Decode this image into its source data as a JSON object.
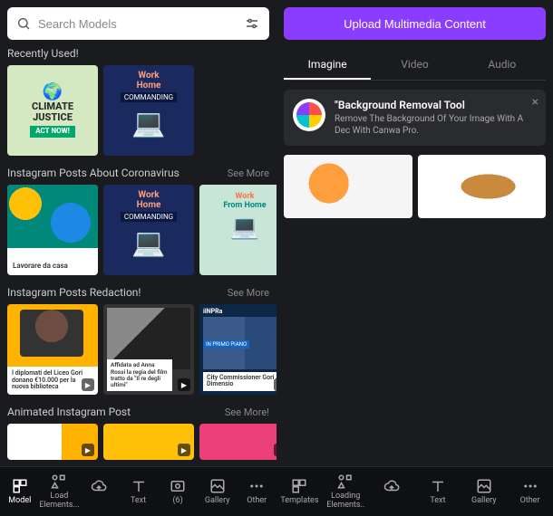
{
  "search": {
    "placeholder": "Search Models"
  },
  "sections": [
    {
      "title": "Recently Used!",
      "see_more": null,
      "templates": [
        {
          "name": "climate-justice-template",
          "line1": "CLIMATE",
          "line2": "JUSTICE",
          "cta": "ACT NOW!"
        },
        {
          "name": "work-home-blue-template",
          "title": "Work",
          "sub": "Home",
          "tag": "COMMANDING"
        }
      ]
    },
    {
      "title": "Instagram Posts About Coronavirus",
      "see_more": "See More",
      "templates": [
        {
          "name": "lavorare-da-casa-template",
          "caption": "Lavorare da casa"
        },
        {
          "name": "work-home-blue-template-2",
          "title": "Work",
          "sub": "Home",
          "tag": "COMMANDING"
        },
        {
          "name": "work-from-home-green-template",
          "line1": "Work",
          "line2": "From Home"
        }
      ]
    },
    {
      "title": "Instagram Posts Redaction!",
      "see_more": "See More",
      "templates": [
        {
          "name": "liceo-gori-template",
          "caption": "I diplomati del Liceo Gori donano €10.000 per la nuova biblioteca"
        },
        {
          "name": "anna-rossi-template",
          "caption": "Affidata ad Anna Rossi la regia del film tratto da \"Il re degli ultimi\""
        },
        {
          "name": "city-commissioner-template",
          "tag": "IN PRIMO PIANO",
          "caption": "City Commissioner Gori A Dimensio",
          "logo": "ilNPRa"
        }
      ]
    },
    {
      "title": "Animated Instagram Post",
      "see_more": "See More!",
      "templates": [
        {
          "name": "animated-template-1"
        },
        {
          "name": "animated-template-2"
        },
        {
          "name": "animated-template-3"
        }
      ]
    }
  ],
  "left_nav": [
    {
      "label": "Model",
      "icon": "templates-icon",
      "active": true
    },
    {
      "label": "Load Elements...",
      "icon": "elements-icon",
      "active": false
    },
    {
      "label": "Text",
      "icon": "text-icon",
      "active": false
    },
    {
      "label": "(6)",
      "icon": "photos-icon",
      "active": false
    },
    {
      "label": "Gallery",
      "icon": "gallery-icon",
      "active": false
    },
    {
      "label": "Other",
      "icon": "more-icon",
      "active": false
    }
  ],
  "right": {
    "upload_button": "Upload Multimedia Content",
    "tabs": [
      {
        "label": "Imagine",
        "active": true
      },
      {
        "label": "Video",
        "active": false
      },
      {
        "label": "Audio",
        "active": false
      }
    ],
    "promo": {
      "title": "\"Background Removal Tool",
      "desc": "Remove The Background Of Your Image With A Dec With Canwa Pro."
    },
    "uploads": [
      {
        "name": "upload-food-1"
      },
      {
        "name": "upload-croissant"
      }
    ]
  },
  "right_nav": [
    {
      "label": "Templates",
      "icon": "templates-icon"
    },
    {
      "label": "Loading Elements..",
      "icon": "elements-icon"
    },
    {
      "label": "Text",
      "icon": "text-icon"
    },
    {
      "label": "Gallery",
      "icon": "gallery-icon"
    },
    {
      "label": "Other",
      "icon": "more-icon"
    }
  ]
}
